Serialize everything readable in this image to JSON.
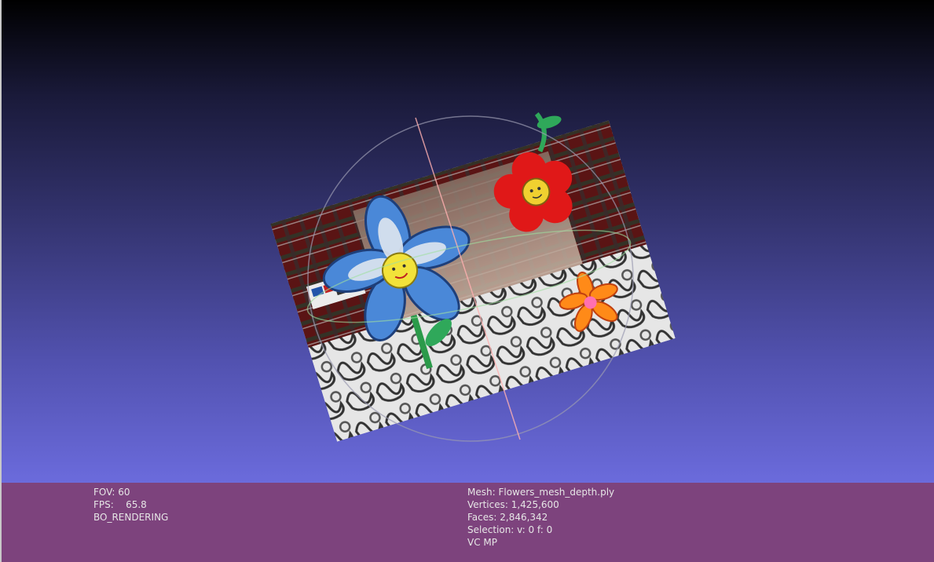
{
  "viewer": {
    "mesh_description": "Textured 3D scan of flower drawings",
    "colors": {
      "background_top": "#000000",
      "background_bottom": "#6b6bdc",
      "info_bar": "#7d437d",
      "text": "#e6e6e6"
    }
  },
  "info_left": {
    "fov": "FOV: 60",
    "fps_label": "FPS:",
    "fps_value": "65.8",
    "render_mode": "BO_RENDERING"
  },
  "info_right": {
    "mesh": "Mesh: Flowers_mesh_depth.ply",
    "vertices": "Vertices: 1,425,600",
    "faces": "Faces: 2,846,342",
    "selection": "Selection: v: 0 f: 0",
    "mode": "VC MP"
  }
}
